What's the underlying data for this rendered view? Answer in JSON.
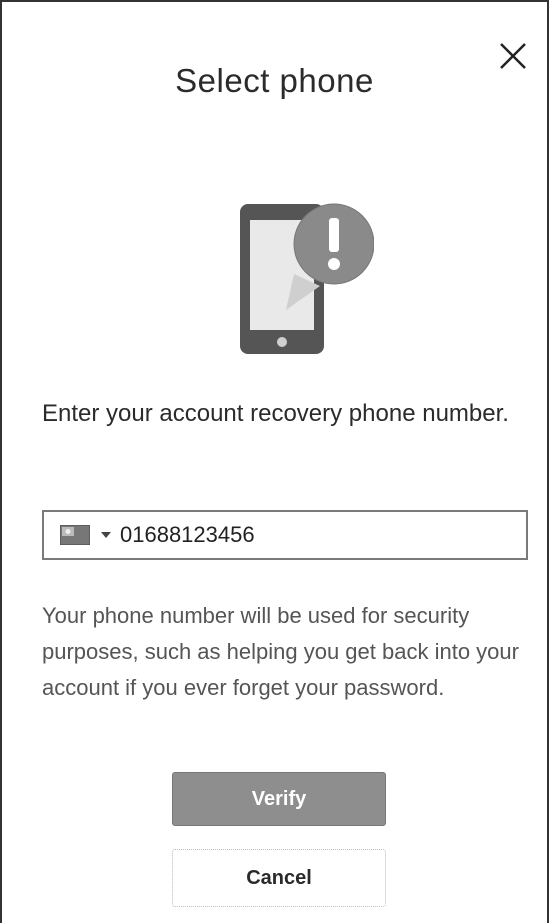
{
  "dialog": {
    "title": "Select phone",
    "close_icon": "close-icon",
    "illustration_icon": "phone-alert-icon",
    "prompt": "Enter your account recovery phone number.",
    "phone_field": {
      "country_flag_icon": "country-flag-icon",
      "dropdown_icon": "chevron-down-icon",
      "value": "01688123456"
    },
    "help_text": "Your phone number will be used for security purposes, such as helping you get back into your account if you ever forget your password.",
    "verify_label": "Verify",
    "cancel_label": "Cancel"
  },
  "colors": {
    "verify_button": "#8e8e8e",
    "text": "#2b2b2b",
    "help_text": "#555555",
    "border": "#333333"
  }
}
